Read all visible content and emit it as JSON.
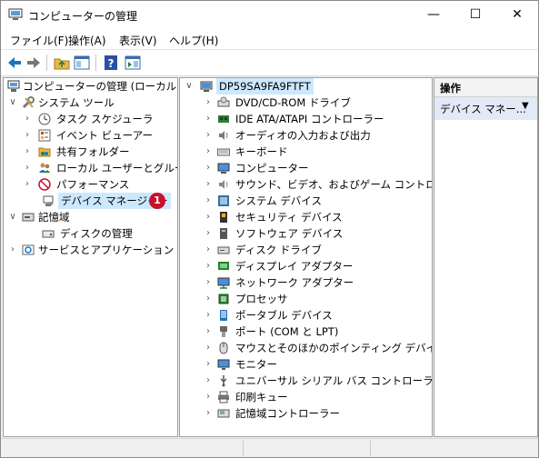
{
  "window": {
    "title": "コンピューターの管理",
    "minimize": "—",
    "maximize": "☐",
    "close": "✕"
  },
  "menu": {
    "file": "ファイル(F)",
    "action": "操作(A)",
    "view": "表示(V)",
    "help": "ヘルプ(H)"
  },
  "left_tree": {
    "root": "コンピューターの管理 (ローカル)",
    "system_tools": "システム ツール",
    "task_scheduler": "タスク スケジューラ",
    "event_viewer": "イベント ビューアー",
    "shared_folders": "共有フォルダー",
    "local_users": "ローカル ユーザーとグループ",
    "performance": "パフォーマンス",
    "device_manager": "デバイス マネージャー",
    "storage": "記憶域",
    "disk_management": "ディスクの管理",
    "services_apps": "サービスとアプリケーション"
  },
  "annotation": {
    "badge": "1"
  },
  "device_tree": {
    "root": "DP59SA9FA9FTFT",
    "items": [
      {
        "label": "DVD/CD-ROM ドライブ",
        "icon": "dvd-drive-icon"
      },
      {
        "label": "IDE ATA/ATAPI コントローラー",
        "icon": "ide-controller-icon"
      },
      {
        "label": "オーディオの入力および出力",
        "icon": "audio-icon"
      },
      {
        "label": "キーボード",
        "icon": "keyboard-icon"
      },
      {
        "label": "コンピューター",
        "icon": "computer-icon"
      },
      {
        "label": "サウンド、ビデオ、およびゲーム コントローラー",
        "icon": "sound-icon"
      },
      {
        "label": "システム デバイス",
        "icon": "system-device-icon"
      },
      {
        "label": "セキュリティ デバイス",
        "icon": "security-device-icon"
      },
      {
        "label": "ソフトウェア デバイス",
        "icon": "software-device-icon"
      },
      {
        "label": "ディスク ドライブ",
        "icon": "disk-drive-icon"
      },
      {
        "label": "ディスプレイ アダプター",
        "icon": "display-adapter-icon"
      },
      {
        "label": "ネットワーク アダプター",
        "icon": "network-adapter-icon"
      },
      {
        "label": "プロセッサ",
        "icon": "processor-icon"
      },
      {
        "label": "ポータブル デバイス",
        "icon": "portable-device-icon"
      },
      {
        "label": "ポート (COM と LPT)",
        "icon": "port-icon"
      },
      {
        "label": "マウスとそのほかのポインティング デバイス",
        "icon": "mouse-icon"
      },
      {
        "label": "モニター",
        "icon": "monitor-icon"
      },
      {
        "label": "ユニバーサル シリアル バス コントローラー",
        "icon": "usb-icon"
      },
      {
        "label": "印刷キュー",
        "icon": "printer-icon"
      },
      {
        "label": "記憶域コントローラー",
        "icon": "storage-controller-icon"
      }
    ]
  },
  "actions_pane": {
    "header": "操作",
    "item": "デバイス マネー..."
  },
  "colors": {
    "selection": "#cce8ff",
    "accent_blue": "#1e73be",
    "badge": "#c8102e",
    "actions_bg": "#e1eaf6"
  }
}
